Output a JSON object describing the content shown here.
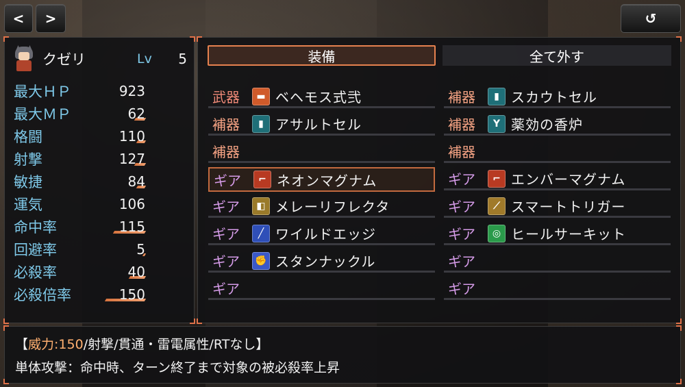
{
  "nav": {
    "prev_glyph": "<",
    "next_glyph": ">",
    "back_glyph": "↺"
  },
  "character": {
    "name": "クゼリ",
    "level_label": "Lv",
    "level": "5"
  },
  "stats": [
    {
      "label": "最大ＨＰ",
      "value": "923",
      "gauge": 0.0
    },
    {
      "label": "最大ＭＰ",
      "value": "62",
      "gauge": 0.25
    },
    {
      "label": "格闘",
      "value": "110",
      "gauge": 0.2
    },
    {
      "label": "射撃",
      "value": "127",
      "gauge": 0.25
    },
    {
      "label": "敏捷",
      "value": "84",
      "gauge": 0.2
    },
    {
      "label": "運気",
      "value": "106",
      "gauge": 0.0
    },
    {
      "label": "命中率",
      "value": "115",
      "gauge": 0.8
    },
    {
      "label": "回避率",
      "value": "5",
      "gauge": 0.05
    },
    {
      "label": "必殺率",
      "value": "40",
      "gauge": 0.4
    },
    {
      "label": "必殺倍率",
      "value": "150",
      "gauge": 1.0
    }
  ],
  "commands": {
    "equip": "装備",
    "remove_all": "全て外す"
  },
  "slots_left": [
    {
      "type": "武器",
      "kind": "weapon",
      "icon": "gun-icon",
      "name": "ベヘモス式弐"
    },
    {
      "type": "補器",
      "kind": "aux",
      "icon": "cell-icon",
      "name": "アサルトセル"
    },
    {
      "type": "補器",
      "kind": "aux",
      "icon": "",
      "name": ""
    },
    {
      "type": "ギア",
      "kind": "gear",
      "icon": "revolver-icon",
      "name": "ネオンマグナム",
      "selected": true
    },
    {
      "type": "ギア",
      "kind": "gear",
      "icon": "reflector-icon",
      "name": "メレーリフレクタ"
    },
    {
      "type": "ギア",
      "kind": "gear",
      "icon": "sword-icon",
      "name": "ワイルドエッジ"
    },
    {
      "type": "ギア",
      "kind": "gear",
      "icon": "knuckle-icon",
      "name": "スタンナックル"
    },
    {
      "type": "ギア",
      "kind": "gear",
      "icon": "",
      "name": ""
    }
  ],
  "slots_right": [
    {
      "type": "補器",
      "kind": "aux",
      "icon": "cell-icon",
      "name": "スカウトセル"
    },
    {
      "type": "補器",
      "kind": "aux",
      "icon": "censer-icon",
      "name": "薬効の香炉"
    },
    {
      "type": "補器",
      "kind": "aux",
      "icon": "",
      "name": ""
    },
    {
      "type": "ギア",
      "kind": "gear",
      "icon": "revolver-icon",
      "name": "エンバーマグナム"
    },
    {
      "type": "ギア",
      "kind": "gear",
      "icon": "trigger-icon",
      "name": "スマートトリガー"
    },
    {
      "type": "ギア",
      "kind": "gear",
      "icon": "circuit-icon",
      "name": "ヒールサーキット"
    },
    {
      "type": "ギア",
      "kind": "gear",
      "icon": "",
      "name": ""
    },
    {
      "type": "ギア",
      "kind": "gear",
      "icon": "",
      "name": ""
    }
  ],
  "help": {
    "open_bracket": "【",
    "power_label": "威力:",
    "power_value": "150",
    "attributes": "/射撃/貫通・雷電属性/RTなし】",
    "description": "単体攻撃：命中時、ターン終了まで対象の被必殺率上昇"
  },
  "colors": {
    "accent": "#e7824f",
    "stat_label": "#7ec8e8",
    "weapon_type": "#f08a78",
    "aux_type": "#f4a283",
    "gear_type": "#d59be8",
    "power_value": "#ffb070"
  },
  "icon_styles": {
    "gun-icon": {
      "bg": "#d05a2a",
      "glyph": "▬"
    },
    "cell-icon": {
      "bg": "#1f6f78",
      "glyph": "▮"
    },
    "revolver-icon": {
      "bg": "#b83a22",
      "glyph": "⌐"
    },
    "reflector-icon": {
      "bg": "#9a7a2a",
      "glyph": "◧"
    },
    "sword-icon": {
      "bg": "#2f4fb8",
      "glyph": "╱"
    },
    "knuckle-icon": {
      "bg": "#3a58c8",
      "glyph": "✊"
    },
    "censer-icon": {
      "bg": "#1f6f78",
      "glyph": "Y"
    },
    "trigger-icon": {
      "bg": "#a07a2a",
      "glyph": "⟋"
    },
    "circuit-icon": {
      "bg": "#2a9a4a",
      "glyph": "◎"
    }
  }
}
